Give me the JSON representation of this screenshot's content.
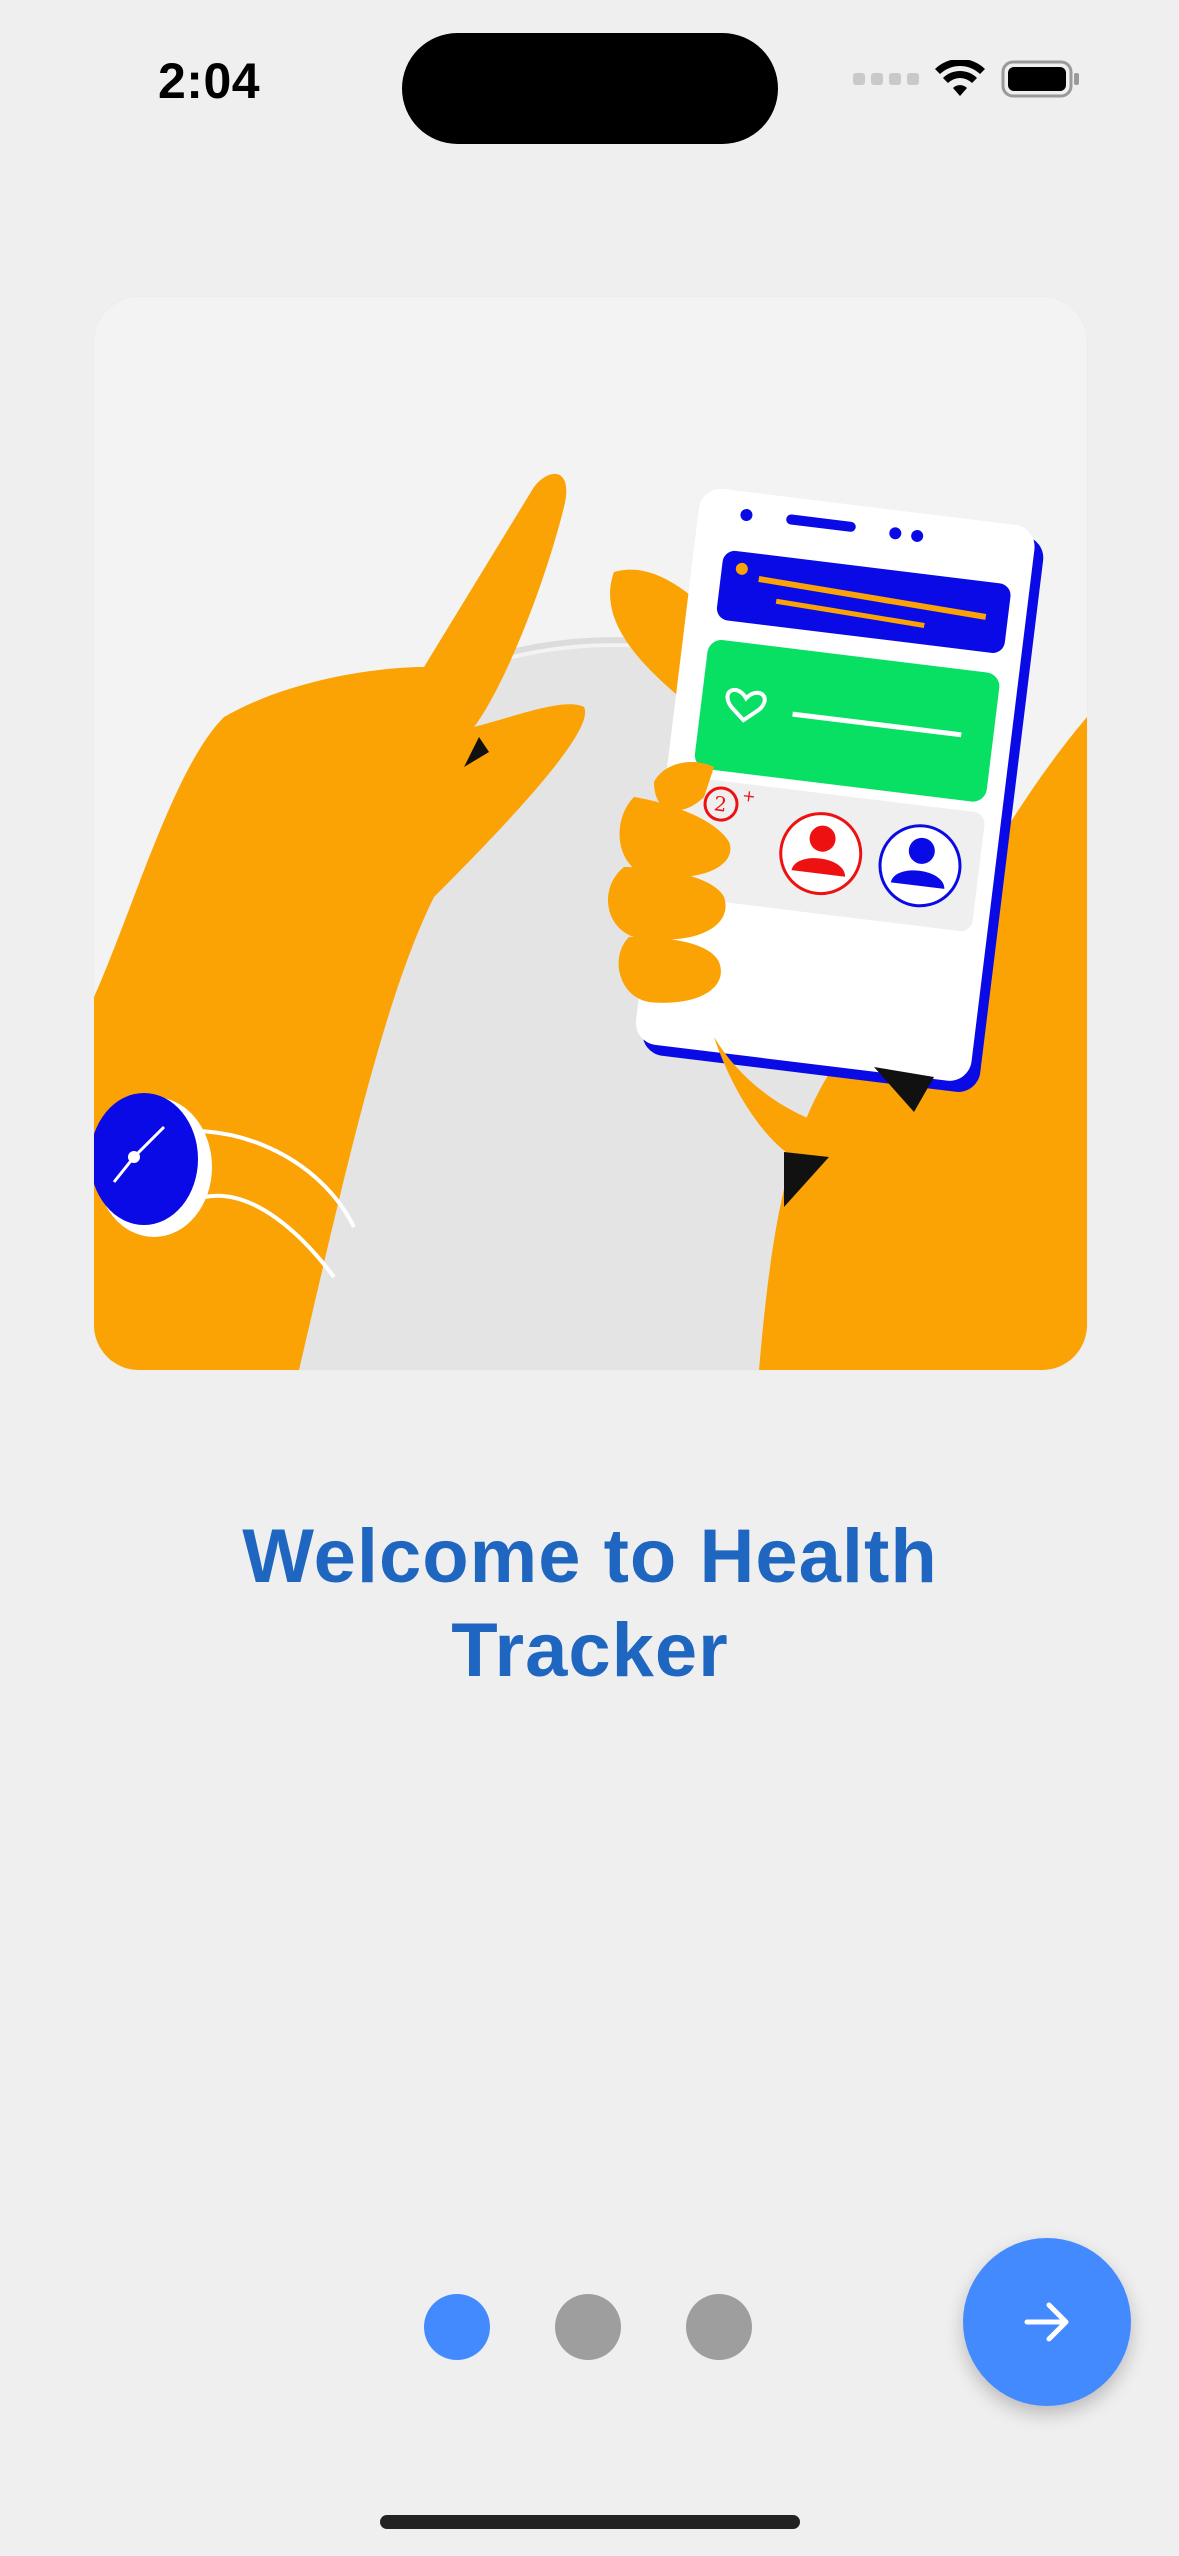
{
  "status_bar": {
    "time": "2:04"
  },
  "onboarding": {
    "title": "Welcome to Health Tracker",
    "illustration": "hands-holding-phone-health-app-illustration",
    "page_indicator": {
      "total": 3,
      "active_index": 0
    },
    "next_button_icon": "arrow-right-icon"
  },
  "colors": {
    "background": "#efefef",
    "title": "#1f66c1",
    "accent": "#448aff",
    "inactive_dot": "#9e9e9e",
    "illustration_skin": "#fba204",
    "illustration_blue": "#0a0ae6",
    "illustration_green": "#08e064"
  }
}
